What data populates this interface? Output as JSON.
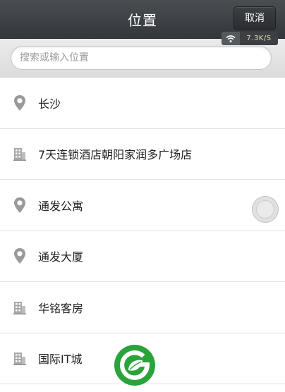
{
  "header": {
    "title": "位置",
    "cancel_label": "取消"
  },
  "network_indicator": {
    "icon": "wifi-icon",
    "speed": "7.3K/S"
  },
  "search": {
    "placeholder": "搜索或输入位置",
    "value": ""
  },
  "locations": [
    {
      "name": "长沙",
      "icon": "map-pin-icon"
    },
    {
      "name": "7天连锁酒店朝阳家润多广场店",
      "icon": "building-icon"
    },
    {
      "name": "通发公寓",
      "icon": "map-pin-icon"
    },
    {
      "name": "通发大厦",
      "icon": "map-pin-icon"
    },
    {
      "name": "华铭客房",
      "icon": "building-icon"
    },
    {
      "name": "国际IT城",
      "icon": "building-icon"
    }
  ],
  "colors": {
    "header_bg": "#3a3d41",
    "icon_gray": "#9a9a9a",
    "logo_green": "#2aa33b",
    "speed_text": "#e8d9b8"
  }
}
